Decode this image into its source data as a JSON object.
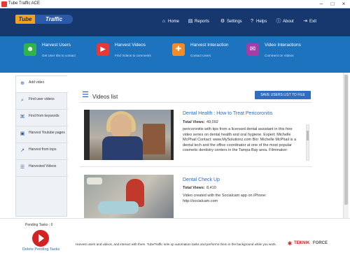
{
  "window": {
    "title": "Tube Traffic ACE"
  },
  "logo": {
    "part1": "Tube",
    "part2": "Traffic"
  },
  "nav": [
    {
      "label": "Home",
      "icon": "home-icon"
    },
    {
      "label": "Reports",
      "icon": "chart-icon"
    },
    {
      "label": "Settings",
      "icon": "gear-icon"
    },
    {
      "label": "Helps",
      "icon": "help-icon"
    },
    {
      "label": "About",
      "icon": "info-icon"
    },
    {
      "label": "Exit",
      "icon": "exit-icon"
    }
  ],
  "features": [
    {
      "title": "Harvest Users",
      "sub": "Get User IDs to contact",
      "icon": "user-icon",
      "color": "#2fb34a"
    },
    {
      "title": "Harvest Videos",
      "sub": "Find Videos to comments",
      "icon": "video-icon",
      "color": "#e53935"
    },
    {
      "title": "Harvest Interaction",
      "sub": "Contact Users",
      "icon": "interaction-icon",
      "color": "#f28c28"
    },
    {
      "title": "Video Interactions",
      "sub": "Comment on Videos",
      "icon": "comment-icon",
      "color": "#a23ea6"
    }
  ],
  "sidebar": [
    {
      "label": "Add video",
      "icon": "add-video-icon"
    },
    {
      "label": "Find user videos",
      "icon": "search-icon"
    },
    {
      "label": "Find from keywords",
      "icon": "keyword-icon"
    },
    {
      "label": "Harvest Youtube pages",
      "icon": "youtube-icon"
    },
    {
      "label": "Harvest from tops",
      "icon": "trending-icon"
    },
    {
      "label": "Harvested Videos",
      "icon": "list-icon"
    }
  ],
  "main": {
    "title": "Videos list",
    "save_label": "SAVE USERS LIST TO FILE",
    "videos": [
      {
        "title": "Dental Health : How to Treat Pericoronitis",
        "views_label": "Total Views:",
        "views": "49,092",
        "description": "pericoronitis with tips from a licensed dental assistant in this free video series on dental health and oral hygiene. Expert: Michelle McPhail Contact: www.MySolutionz.com Bio: Michelle McPhail is a dental tech and the office coordinator at one of the most popular cosmetic dentistry centers in the Tampa Bay area. Filmmaker:"
      },
      {
        "title": "Dental Check Up",
        "views_label": "Total Views:",
        "views": "8,410",
        "description": "Video created with the Socialcam app on iPhone: http://socialcam.com"
      }
    ]
  },
  "footer": {
    "pending": "Pending Tasks : 0",
    "delete_label": "Delete Pending Tasks",
    "tagline": "Harvest users and videos, and interact with them. TubeTraffic sets up automation tasks and performs them in the background while you work.",
    "brand1": "TEKNIK",
    "brand2": "FORCE"
  }
}
